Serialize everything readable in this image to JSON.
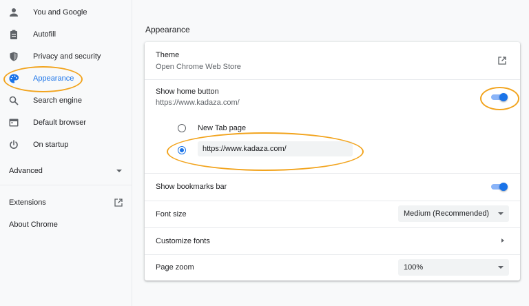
{
  "sidebar": {
    "items": [
      {
        "label": "You and Google",
        "icon": "person-icon"
      },
      {
        "label": "Autofill",
        "icon": "clipboard-icon"
      },
      {
        "label": "Privacy and security",
        "icon": "shield-icon"
      },
      {
        "label": "Appearance",
        "icon": "palette-icon",
        "active": true
      },
      {
        "label": "Search engine",
        "icon": "search-icon"
      },
      {
        "label": "Default browser",
        "icon": "browser-window-icon"
      },
      {
        "label": "On startup",
        "icon": "power-icon"
      }
    ],
    "advanced_label": "Advanced",
    "extensions_label": "Extensions",
    "about_label": "About Chrome"
  },
  "main": {
    "section_title": "Appearance",
    "theme": {
      "title": "Theme",
      "subtitle": "Open Chrome Web Store"
    },
    "home_button": {
      "title": "Show home button",
      "subtitle": "https://www.kadaza.com/",
      "enabled": true,
      "option_new_tab": "New Tab page",
      "custom_url": "https://www.kadaza.com/",
      "selected": "custom"
    },
    "bookmarks_bar": {
      "title": "Show bookmarks bar",
      "enabled": true
    },
    "font_size": {
      "title": "Font size",
      "value": "Medium (Recommended)"
    },
    "customize_fonts": {
      "title": "Customize fonts"
    },
    "page_zoom": {
      "title": "Page zoom",
      "value": "100%"
    }
  },
  "colors": {
    "accent": "#1a73e8",
    "highlight": "#f2a41e"
  }
}
